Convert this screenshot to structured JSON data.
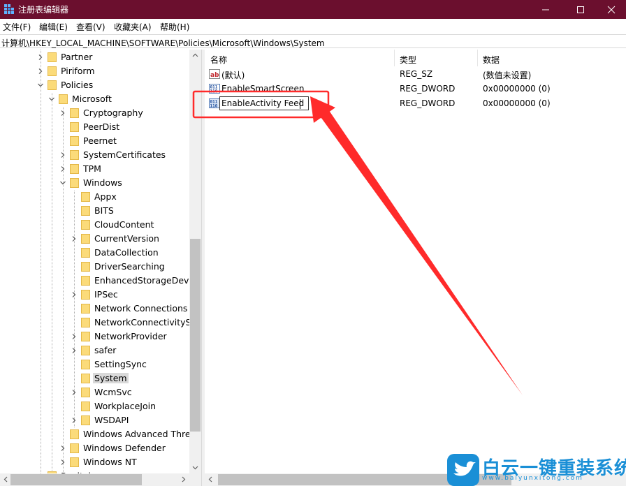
{
  "window": {
    "title": "注册表编辑器",
    "minimize_icon": "minimize-icon",
    "maximize_icon": "maximize-icon",
    "close_icon": "close-icon"
  },
  "menu": [
    "文件(F)",
    "编辑(E)",
    "查看(V)",
    "收藏夹(A)",
    "帮助(H)"
  ],
  "address": "计算机\\HKEY_LOCAL_MACHINE\\SOFTWARE\\Policies\\Microsoft\\Windows\\System",
  "tree": [
    {
      "label": "Partner",
      "level": 0,
      "expander": "collapsed"
    },
    {
      "label": "Piriform",
      "level": 0,
      "expander": "collapsed"
    },
    {
      "label": "Policies",
      "level": 0,
      "expander": "expanded"
    },
    {
      "label": "Microsoft",
      "level": 1,
      "expander": "expanded"
    },
    {
      "label": "Cryptography",
      "level": 2,
      "expander": "collapsed"
    },
    {
      "label": "PeerDist",
      "level": 2,
      "expander": "none"
    },
    {
      "label": "Peernet",
      "level": 2,
      "expander": "none"
    },
    {
      "label": "SystemCertificates",
      "level": 2,
      "expander": "collapsed"
    },
    {
      "label": "TPM",
      "level": 2,
      "expander": "collapsed"
    },
    {
      "label": "Windows",
      "level": 2,
      "expander": "expanded"
    },
    {
      "label": "Appx",
      "level": 3,
      "expander": "none"
    },
    {
      "label": "BITS",
      "level": 3,
      "expander": "none"
    },
    {
      "label": "CloudContent",
      "level": 3,
      "expander": "none"
    },
    {
      "label": "CurrentVersion",
      "level": 3,
      "expander": "collapsed"
    },
    {
      "label": "DataCollection",
      "level": 3,
      "expander": "none"
    },
    {
      "label": "DriverSearching",
      "level": 3,
      "expander": "none"
    },
    {
      "label": "EnhancedStorageDevices",
      "level": 3,
      "expander": "none"
    },
    {
      "label": "IPSec",
      "level": 3,
      "expander": "collapsed"
    },
    {
      "label": "Network Connections",
      "level": 3,
      "expander": "none"
    },
    {
      "label": "NetworkConnectivityStatusIndicator",
      "level": 3,
      "expander": "none"
    },
    {
      "label": "NetworkProvider",
      "level": 3,
      "expander": "collapsed"
    },
    {
      "label": "safer",
      "level": 3,
      "expander": "collapsed"
    },
    {
      "label": "SettingSync",
      "level": 3,
      "expander": "none"
    },
    {
      "label": "System",
      "level": 3,
      "expander": "none",
      "selected": true
    },
    {
      "label": "WcmSvc",
      "level": 3,
      "expander": "collapsed"
    },
    {
      "label": "WorkplaceJoin",
      "level": 3,
      "expander": "none"
    },
    {
      "label": "WSDAPI",
      "level": 3,
      "expander": "collapsed"
    },
    {
      "label": "Windows Advanced Threat Protection",
      "level": 2,
      "expander": "none"
    },
    {
      "label": "Windows Defender",
      "level": 2,
      "expander": "collapsed"
    },
    {
      "label": "Windows NT",
      "level": 2,
      "expander": "collapsed"
    },
    {
      "label": "Realtek",
      "level": 0,
      "expander": "collapsed"
    }
  ],
  "list": {
    "columns": [
      "名称",
      "类型",
      "数据"
    ],
    "rows": [
      {
        "name": "(默认)",
        "type": "REG_SZ",
        "data": "(数值未设置)",
        "icon": "string-value-icon"
      },
      {
        "name": "EnableSmartScreen",
        "type": "REG_DWORD",
        "data": "0x00000000 (0)",
        "icon": "dword-value-icon"
      },
      {
        "name": "EnableActivity Feed",
        "type": "REG_DWORD",
        "data": "0x00000000 (0)",
        "icon": "dword-value-icon",
        "editing": true
      }
    ]
  },
  "annotation": {
    "color": "#ff2a2a"
  },
  "watermark": {
    "title": "白云一键重装系统",
    "url": "www.baiyunxitong.com",
    "icon": "bird-icon",
    "color": "#1a8fd6"
  }
}
